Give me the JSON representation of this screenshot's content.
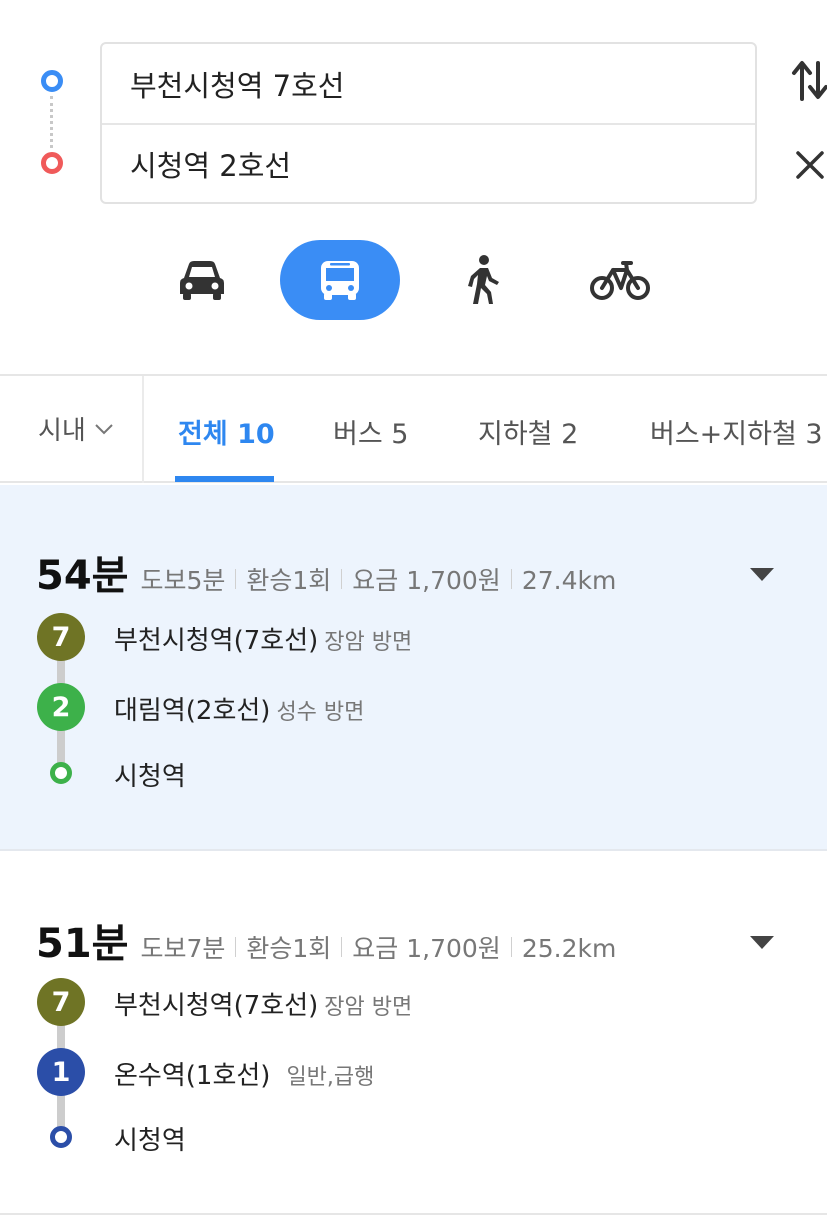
{
  "search": {
    "origin": "부천시청역 7호선",
    "destination": "시청역 2호선"
  },
  "modes": [
    "car",
    "bus",
    "walk",
    "bike"
  ],
  "selected_mode": "bus",
  "tabs": {
    "area": "시내",
    "items": [
      {
        "label": "전체 10",
        "active": true
      },
      {
        "label": "버스 5",
        "active": false
      },
      {
        "label": "지하철 2",
        "active": false
      },
      {
        "label": "버스+지하철 3",
        "active": false
      }
    ]
  },
  "routes": [
    {
      "duration": "54분",
      "walk": "도보5분",
      "transfer": "환승1회",
      "fare": "요금 1,700원",
      "distance": "27.4km",
      "selected": true,
      "stops": [
        {
          "badge": "7",
          "color": "#6f7425",
          "name": "부천시청역(7호선)",
          "direction": "장암 방면"
        },
        {
          "badge": "2",
          "color": "#3db14a",
          "name": "대림역(2호선)",
          "direction": "성수 방면"
        },
        {
          "badge": "",
          "color": "#3db14a",
          "name": "시청역",
          "direction": ""
        }
      ]
    },
    {
      "duration": "51분",
      "walk": "도보7분",
      "transfer": "환승1회",
      "fare": "요금 1,700원",
      "distance": "25.2km",
      "selected": false,
      "stops": [
        {
          "badge": "7",
          "color": "#6f7425",
          "name": "부천시청역(7호선)",
          "direction": "장암 방면"
        },
        {
          "badge": "1",
          "color": "#2b4ea8",
          "name": "온수역(1호선)",
          "direction": "일반,급행"
        },
        {
          "badge": "",
          "color": "#2b4ea8",
          "name": "시청역",
          "direction": ""
        }
      ]
    }
  ],
  "colors": {
    "accent": "#2e87f0",
    "origin_marker": "#3a8df5",
    "destination_marker": "#f05a5a",
    "selected_route_bg": "#edf4fd"
  }
}
